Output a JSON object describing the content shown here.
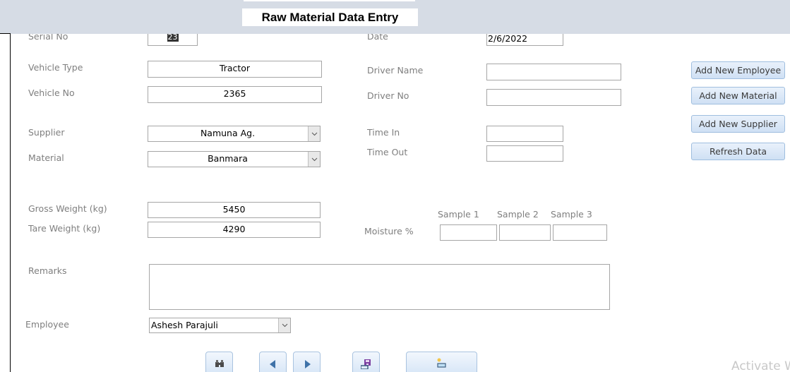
{
  "form": {
    "title": "Raw Material Data Entry"
  },
  "fields": {
    "serial_no": {
      "label": "Serial No",
      "value": "23"
    },
    "date": {
      "label": "Date",
      "value": "2/6/2022"
    },
    "vehicle_type": {
      "label": "Vehicle Type",
      "value": "Tractor"
    },
    "vehicle_no": {
      "label": "Vehicle No",
      "value": "2365"
    },
    "driver_name": {
      "label": "Driver Name",
      "value": ""
    },
    "driver_no": {
      "label": "Driver No",
      "value": ""
    },
    "supplier": {
      "label": "Supplier",
      "value": "Namuna Ag."
    },
    "material": {
      "label": "Material",
      "value": "Banmara"
    },
    "time_in": {
      "label": "Time In",
      "value": ""
    },
    "time_out": {
      "label": "Time Out",
      "value": ""
    },
    "gross_weight": {
      "label": "Gross Weight (kg)",
      "value": "5450"
    },
    "tare_weight": {
      "label": "Tare Weight (kg)",
      "value": "4290"
    },
    "moisture": {
      "label": "Moisture %",
      "samples": [
        {
          "label": "Sample 1",
          "value": ""
        },
        {
          "label": "Sample 2",
          "value": ""
        },
        {
          "label": "Sample 3",
          "value": ""
        }
      ]
    },
    "remarks": {
      "label": "Remarks",
      "value": ""
    },
    "employee": {
      "label": "Employee",
      "value": "Ashesh Parajuli"
    }
  },
  "side_buttons": {
    "add_employee": "Add New Employee",
    "add_material": "Add New Material",
    "add_supplier": "Add New Supplier",
    "refresh": "Refresh Data"
  },
  "nav_buttons": [
    {
      "name": "find",
      "icon": "binoculars-icon"
    },
    {
      "name": "previous-record",
      "icon": "arrow-left-icon"
    },
    {
      "name": "next-record",
      "icon": "arrow-right-icon"
    },
    {
      "name": "save-record",
      "icon": "save-icon"
    },
    {
      "name": "new-record",
      "icon": "new-record-icon"
    }
  ],
  "colors": {
    "header_band": "#d6dce5",
    "label_text": "#7f7f7f",
    "button_border": "#9fbedf",
    "save_icon": "#7b3fa0",
    "arrow_icon": "#3f72a8"
  },
  "watermark": "Activate W"
}
